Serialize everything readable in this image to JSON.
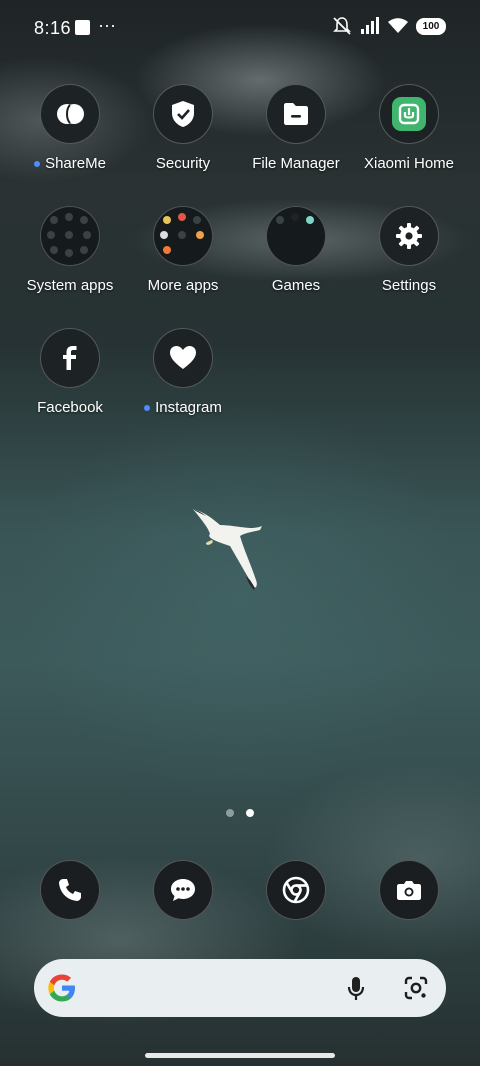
{
  "status_bar": {
    "time": "8:16",
    "more": "···",
    "battery": "100"
  },
  "apps": [
    {
      "label": "ShareMe",
      "new": true
    },
    {
      "label": "Security",
      "new": false
    },
    {
      "label": "File Manager",
      "new": false
    },
    {
      "label": "Xiaomi Home",
      "new": false
    },
    {
      "label": "System apps",
      "new": false
    },
    {
      "label": "More apps",
      "new": false
    },
    {
      "label": "Games",
      "new": false
    },
    {
      "label": "Settings",
      "new": false
    },
    {
      "label": "Facebook",
      "new": false
    },
    {
      "label": "Instagram",
      "new": true
    }
  ],
  "page_indicator": {
    "pages": 2,
    "current": 2
  },
  "dock": [
    "phone-icon",
    "messages-icon",
    "chrome-icon",
    "camera-icon"
  ],
  "colors": {
    "accent": "#4f8cff",
    "xiaomi_home": "#3fb56e",
    "search_bg": "#e9eef0"
  }
}
